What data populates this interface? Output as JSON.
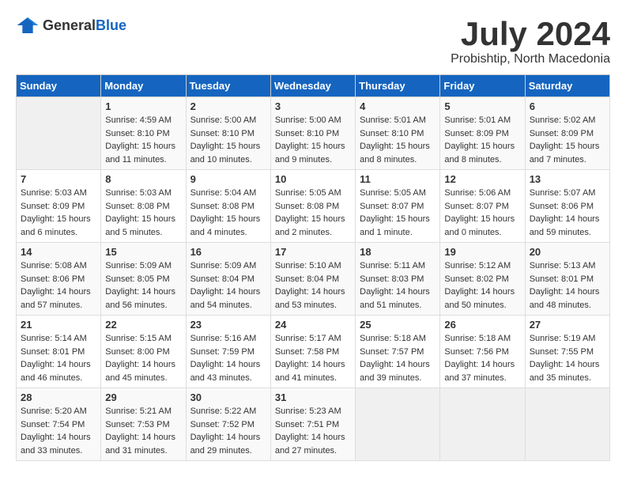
{
  "header": {
    "logo": {
      "general": "General",
      "blue": "Blue"
    },
    "title": "July 2024",
    "location": "Probishtip, North Macedonia"
  },
  "calendar": {
    "days_of_week": [
      "Sunday",
      "Monday",
      "Tuesday",
      "Wednesday",
      "Thursday",
      "Friday",
      "Saturday"
    ],
    "weeks": [
      [
        {
          "day": "",
          "info": ""
        },
        {
          "day": "1",
          "info": "Sunrise: 4:59 AM\nSunset: 8:10 PM\nDaylight: 15 hours\nand 11 minutes."
        },
        {
          "day": "2",
          "info": "Sunrise: 5:00 AM\nSunset: 8:10 PM\nDaylight: 15 hours\nand 10 minutes."
        },
        {
          "day": "3",
          "info": "Sunrise: 5:00 AM\nSunset: 8:10 PM\nDaylight: 15 hours\nand 9 minutes."
        },
        {
          "day": "4",
          "info": "Sunrise: 5:01 AM\nSunset: 8:10 PM\nDaylight: 15 hours\nand 8 minutes."
        },
        {
          "day": "5",
          "info": "Sunrise: 5:01 AM\nSunset: 8:09 PM\nDaylight: 15 hours\nand 8 minutes."
        },
        {
          "day": "6",
          "info": "Sunrise: 5:02 AM\nSunset: 8:09 PM\nDaylight: 15 hours\nand 7 minutes."
        }
      ],
      [
        {
          "day": "7",
          "info": "Sunrise: 5:03 AM\nSunset: 8:09 PM\nDaylight: 15 hours\nand 6 minutes."
        },
        {
          "day": "8",
          "info": "Sunrise: 5:03 AM\nSunset: 8:08 PM\nDaylight: 15 hours\nand 5 minutes."
        },
        {
          "day": "9",
          "info": "Sunrise: 5:04 AM\nSunset: 8:08 PM\nDaylight: 15 hours\nand 4 minutes."
        },
        {
          "day": "10",
          "info": "Sunrise: 5:05 AM\nSunset: 8:08 PM\nDaylight: 15 hours\nand 2 minutes."
        },
        {
          "day": "11",
          "info": "Sunrise: 5:05 AM\nSunset: 8:07 PM\nDaylight: 15 hours\nand 1 minute."
        },
        {
          "day": "12",
          "info": "Sunrise: 5:06 AM\nSunset: 8:07 PM\nDaylight: 15 hours\nand 0 minutes."
        },
        {
          "day": "13",
          "info": "Sunrise: 5:07 AM\nSunset: 8:06 PM\nDaylight: 14 hours\nand 59 minutes."
        }
      ],
      [
        {
          "day": "14",
          "info": "Sunrise: 5:08 AM\nSunset: 8:06 PM\nDaylight: 14 hours\nand 57 minutes."
        },
        {
          "day": "15",
          "info": "Sunrise: 5:09 AM\nSunset: 8:05 PM\nDaylight: 14 hours\nand 56 minutes."
        },
        {
          "day": "16",
          "info": "Sunrise: 5:09 AM\nSunset: 8:04 PM\nDaylight: 14 hours\nand 54 minutes."
        },
        {
          "day": "17",
          "info": "Sunrise: 5:10 AM\nSunset: 8:04 PM\nDaylight: 14 hours\nand 53 minutes."
        },
        {
          "day": "18",
          "info": "Sunrise: 5:11 AM\nSunset: 8:03 PM\nDaylight: 14 hours\nand 51 minutes."
        },
        {
          "day": "19",
          "info": "Sunrise: 5:12 AM\nSunset: 8:02 PM\nDaylight: 14 hours\nand 50 minutes."
        },
        {
          "day": "20",
          "info": "Sunrise: 5:13 AM\nSunset: 8:01 PM\nDaylight: 14 hours\nand 48 minutes."
        }
      ],
      [
        {
          "day": "21",
          "info": "Sunrise: 5:14 AM\nSunset: 8:01 PM\nDaylight: 14 hours\nand 46 minutes."
        },
        {
          "day": "22",
          "info": "Sunrise: 5:15 AM\nSunset: 8:00 PM\nDaylight: 14 hours\nand 45 minutes."
        },
        {
          "day": "23",
          "info": "Sunrise: 5:16 AM\nSunset: 7:59 PM\nDaylight: 14 hours\nand 43 minutes."
        },
        {
          "day": "24",
          "info": "Sunrise: 5:17 AM\nSunset: 7:58 PM\nDaylight: 14 hours\nand 41 minutes."
        },
        {
          "day": "25",
          "info": "Sunrise: 5:18 AM\nSunset: 7:57 PM\nDaylight: 14 hours\nand 39 minutes."
        },
        {
          "day": "26",
          "info": "Sunrise: 5:18 AM\nSunset: 7:56 PM\nDaylight: 14 hours\nand 37 minutes."
        },
        {
          "day": "27",
          "info": "Sunrise: 5:19 AM\nSunset: 7:55 PM\nDaylight: 14 hours\nand 35 minutes."
        }
      ],
      [
        {
          "day": "28",
          "info": "Sunrise: 5:20 AM\nSunset: 7:54 PM\nDaylight: 14 hours\nand 33 minutes."
        },
        {
          "day": "29",
          "info": "Sunrise: 5:21 AM\nSunset: 7:53 PM\nDaylight: 14 hours\nand 31 minutes."
        },
        {
          "day": "30",
          "info": "Sunrise: 5:22 AM\nSunset: 7:52 PM\nDaylight: 14 hours\nand 29 minutes."
        },
        {
          "day": "31",
          "info": "Sunrise: 5:23 AM\nSunset: 7:51 PM\nDaylight: 14 hours\nand 27 minutes."
        },
        {
          "day": "",
          "info": ""
        },
        {
          "day": "",
          "info": ""
        },
        {
          "day": "",
          "info": ""
        }
      ]
    ]
  }
}
